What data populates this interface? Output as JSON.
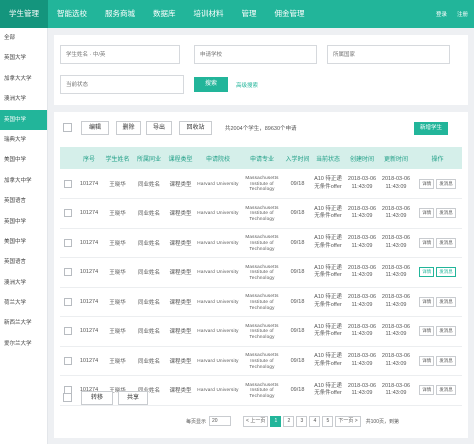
{
  "nav": {
    "items": [
      "学生管理",
      "智能选校",
      "服务商城",
      "数据库",
      "培训材料",
      "管理",
      "佣金管理"
    ],
    "right": [
      "登录",
      "注册"
    ]
  },
  "sidebar": {
    "items": [
      "全部",
      "英国大学",
      "加拿大大学",
      "澳洲大学",
      "英国中学",
      "瑞典大学",
      "美国中学",
      "加拿大中学",
      "英国语言",
      "英国中学",
      "美国中学",
      "英国语言",
      "澳洲大学",
      "荷兰大学",
      "新西兰大学",
      "爱尔兰大学"
    ],
    "active_index": 4
  },
  "filters": {
    "student_name_placeholder": "学生姓名 · 中/英",
    "school_placeholder": "申请学校",
    "country_placeholder": "所属国家",
    "status_placeholder": "当前状态",
    "search_label": "搜索",
    "advanced_label": "高级搜索"
  },
  "toolbar": {
    "edit": "编辑",
    "delete": "删除",
    "export": "导出",
    "recycle": "回收站",
    "info": "共2004个学生，89630个申请",
    "add": "新增学生"
  },
  "table": {
    "headers": [
      "",
      "序号",
      "学生姓名",
      "所属同业",
      "课程类型",
      "申请院校",
      "申请专业",
      "入学时间",
      "当前状态",
      "创建时间",
      "更新时间",
      "操作"
    ],
    "rows": [
      {
        "id": "101274",
        "name": "王晓华",
        "agency": "同业姓名",
        "course": "课程类型",
        "school": "Harvard University",
        "major": "Massachusetts Institute of Technology",
        "intake": "09/18",
        "status_1": "A10 待正递",
        "status_2": "无条件offer",
        "created_date": "2018-03-06",
        "created_time": "11:43:09",
        "updated_date": "2018-03-06",
        "updated_time": "11:43:09",
        "actions": [
          "详情",
          "发消息"
        ],
        "highlight": false
      },
      {
        "id": "101274",
        "name": "王晓华",
        "agency": "同业姓名",
        "course": "课程类型",
        "school": "Harvard University",
        "major": "Massachusetts Institute of Technology",
        "intake": "09/18",
        "status_1": "A10 待正递",
        "status_2": "无条件offer",
        "created_date": "2018-03-06",
        "created_time": "11:43:09",
        "updated_date": "2018-03-06",
        "updated_time": "11:43:09",
        "actions": [
          "详情",
          "发消息"
        ],
        "highlight": false
      },
      {
        "id": "101274",
        "name": "王晓华",
        "agency": "同业姓名",
        "course": "课程类型",
        "school": "Harvard University",
        "major": "Massachusetts Institute of Technology",
        "intake": "09/18",
        "status_1": "A10 待正递",
        "status_2": "无条件offer",
        "created_date": "2018-03-06",
        "created_time": "11:43:09",
        "updated_date": "2018-03-06",
        "updated_time": "11:43:09",
        "actions": [
          "详情",
          "发消息"
        ],
        "highlight": false
      },
      {
        "id": "101274",
        "name": "王晓华",
        "agency": "同业姓名",
        "course": "课程类型",
        "school": "Harvard University",
        "major": "Massachusetts Institute of Technology",
        "intake": "09/18",
        "status_1": "A10 待正递",
        "status_2": "无条件offer",
        "created_date": "2018-03-06",
        "created_time": "11:43:09",
        "updated_date": "2018-03-06",
        "updated_time": "11:43:09",
        "actions": [
          "详情",
          "发消息"
        ],
        "highlight": true
      },
      {
        "id": "101274",
        "name": "王晓华",
        "agency": "同业姓名",
        "course": "课程类型",
        "school": "Harvard University",
        "major": "Massachusetts Institute of Technology",
        "intake": "09/18",
        "status_1": "A10 待正递",
        "status_2": "无条件offer",
        "created_date": "2018-03-06",
        "created_time": "11:43:09",
        "updated_date": "2018-03-06",
        "updated_time": "11:43:09",
        "actions": [
          "详情",
          "发消息"
        ],
        "highlight": false
      },
      {
        "id": "101274",
        "name": "王晓华",
        "agency": "同业姓名",
        "course": "课程类型",
        "school": "Harvard University",
        "major": "Massachusetts Institute of Technology",
        "intake": "09/18",
        "status_1": "A10 待正递",
        "status_2": "无条件offer",
        "created_date": "2018-03-06",
        "created_time": "11:43:09",
        "updated_date": "2018-03-06",
        "updated_time": "11:43:09",
        "actions": [
          "详情",
          "发消息"
        ],
        "highlight": false
      },
      {
        "id": "101274",
        "name": "王晓华",
        "agency": "同业姓名",
        "course": "课程类型",
        "school": "Harvard University",
        "major": "Massachusetts Institute of Technology",
        "intake": "09/18",
        "status_1": "A10 待正递",
        "status_2": "无条件offer",
        "created_date": "2018-03-06",
        "created_time": "11:43:09",
        "updated_date": "2018-03-06",
        "updated_time": "11:43:09",
        "actions": [
          "详情",
          "发消息"
        ],
        "highlight": false
      },
      {
        "id": "101274",
        "name": "王晓华",
        "agency": "同业姓名",
        "course": "课程类型",
        "school": "Harvard University",
        "major": "Massachusetts Institute of Technology",
        "intake": "09/18",
        "status_1": "A10 待正递",
        "status_2": "无条件offer",
        "created_date": "2018-03-06",
        "created_time": "11:43:09",
        "updated_date": "2018-03-06",
        "updated_time": "11:43:09",
        "actions": [
          "详情",
          "发消息"
        ],
        "highlight": false
      }
    ]
  },
  "bottom": {
    "transfer": "转移",
    "share": "共享"
  },
  "pagination": {
    "page_size_label": "每页显示",
    "page_size": "20",
    "prev": "< 上一页",
    "pages": [
      "1",
      "2",
      "3",
      "4",
      "5"
    ],
    "active_page": "1",
    "next": "下一页 >",
    "info": "共100页，到第"
  },
  "colors": {
    "accent": "#22b59a",
    "header_bg": "#d5efea"
  }
}
